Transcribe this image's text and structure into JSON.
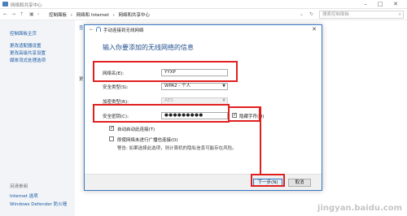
{
  "window": {
    "title": "网络和共享中心"
  },
  "addressbar": {
    "crumbs": [
      "控制面板",
      "›",
      "网络和 Internet",
      "›",
      "网络和共享中心"
    ],
    "search_placeholder": "搜索控制面板"
  },
  "sidebar": {
    "items": [
      "控制面板主页",
      "更改适配器设置",
      "更改高级共享设置",
      "媒体流式处理选项"
    ],
    "see_also_label": "另请参阅",
    "see_also": [
      "Internet 选项",
      "Windows Defender 防火墙"
    ]
  },
  "background": {
    "partial_1": "查",
    "partial_2": "更"
  },
  "dialog": {
    "title": "手动连接到无线网络",
    "close_glyph": "✕",
    "heading": "输入你要添加的无线网络的信息",
    "network_name_label": "网络名(E):",
    "network_name_value": "YYXP",
    "security_type_label": "安全类型(S):",
    "security_type_value": "WPA2 - 个人",
    "encryption_type_label": "加密类型(R):",
    "encryption_type_value": "AES",
    "security_key_label": "安全密钥(C):",
    "security_key_value": "●●●●●●●●●",
    "hide_chars_label": "隐藏字符(H)",
    "auto_connect_label": "自动启动此连接(T)",
    "connect_not_broadcast_label": "即使网络未进行广播也连接(O)",
    "warning": "警告: 如果选择此选项，则计算机的隐私信息可能存在风险。",
    "next_button": "下一步(N)",
    "cancel_button": "取消"
  },
  "watermark": "jingyan.baidu.com"
}
